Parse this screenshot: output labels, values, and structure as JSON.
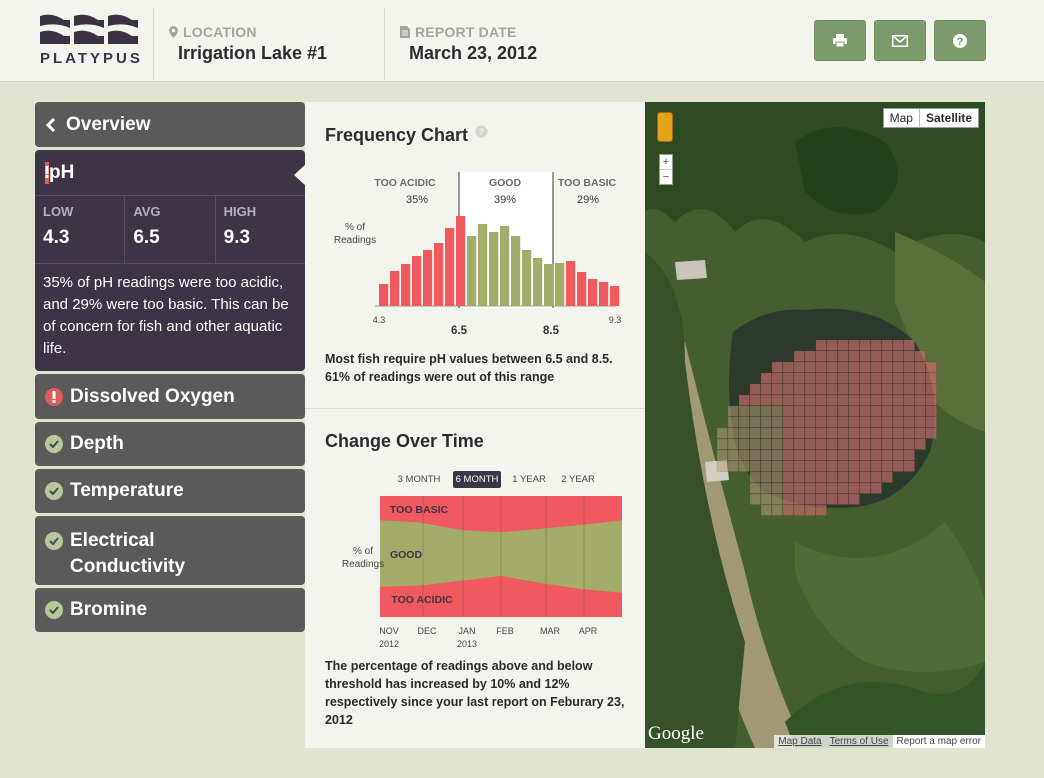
{
  "brand": {
    "name": "PLATYPUS"
  },
  "header": {
    "location_label": "LOCATION",
    "location_value": "Irrigation Lake #1",
    "date_label": "REPORT DATE",
    "date_value": "March 23, 2012",
    "buttons": [
      {
        "name": "print",
        "icon": "printer-icon"
      },
      {
        "name": "email",
        "icon": "envelope-icon"
      },
      {
        "name": "help",
        "icon": "question-icon"
      }
    ]
  },
  "sidebar": {
    "overview": "Overview",
    "active": {
      "title": "pH",
      "stats": [
        {
          "label": "LOW",
          "value": "4.3"
        },
        {
          "label": "AVG",
          "value": "6.5"
        },
        {
          "label": "HIGH",
          "value": "9.3"
        }
      ],
      "description": "35% of pH readings were too acidic, and 29% were too basic. This can be of concern for fish and other aquatic life."
    },
    "items": [
      {
        "label": "Dissolved Oxygen",
        "status": "alert"
      },
      {
        "label": "Depth",
        "status": "ok"
      },
      {
        "label": "Temperature",
        "status": "ok"
      },
      {
        "label": "Electrical Conductivity",
        "status": "ok"
      },
      {
        "label": "Bromine",
        "status": "ok"
      }
    ]
  },
  "frequency": {
    "title": "Frequency Chart",
    "caption": "Most fish require pH values between 6.5 and 8.5. 61% of readings were out of this range",
    "chart_data": {
      "type": "bar",
      "ylabel": "% of Readings",
      "zones": [
        {
          "label": "TOO ACIDIC",
          "pct": "35%"
        },
        {
          "label": "GOOD",
          "pct": "39%"
        },
        {
          "label": "TOO BASIC",
          "pct": "29%"
        }
      ],
      "x_ticks": [
        "4.3",
        "6.5",
        "8.5",
        "9.3"
      ],
      "bins": [
        {
          "v": 0.22,
          "zone": "acid"
        },
        {
          "v": 0.35,
          "zone": "acid"
        },
        {
          "v": 0.42,
          "zone": "acid"
        },
        {
          "v": 0.5,
          "zone": "acid"
        },
        {
          "v": 0.56,
          "zone": "acid"
        },
        {
          "v": 0.63,
          "zone": "acid"
        },
        {
          "v": 0.78,
          "zone": "acid"
        },
        {
          "v": 0.9,
          "zone": "acid"
        },
        {
          "v": 0.7,
          "zone": "good"
        },
        {
          "v": 0.82,
          "zone": "good"
        },
        {
          "v": 0.74,
          "zone": "good"
        },
        {
          "v": 0.8,
          "zone": "good"
        },
        {
          "v": 0.7,
          "zone": "good"
        },
        {
          "v": 0.56,
          "zone": "good"
        },
        {
          "v": 0.48,
          "zone": "good"
        },
        {
          "v": 0.42,
          "zone": "good"
        },
        {
          "v": 0.43,
          "zone": "good"
        },
        {
          "v": 0.45,
          "zone": "basic"
        },
        {
          "v": 0.34,
          "zone": "basic"
        },
        {
          "v": 0.27,
          "zone": "basic"
        },
        {
          "v": 0.24,
          "zone": "basic"
        },
        {
          "v": 0.2,
          "zone": "basic"
        }
      ]
    }
  },
  "change": {
    "title": "Change Over Time",
    "caption": "The percentage of readings above and below threshold has increased by 10% and 12% respectively since your last report on Feburary 23, 2012",
    "tabs": [
      "3 MONTH",
      "6 MONTH",
      "1 YEAR",
      "2 YEAR"
    ],
    "active_tab": "6 MONTH",
    "chart_data": {
      "type": "area",
      "ylabel": "% of Readings",
      "bands": [
        "TOO BASIC",
        "GOOD",
        "TOO ACIDIC"
      ],
      "x_ticks": [
        {
          "m": "NOV",
          "y": "2012"
        },
        {
          "m": "DEC",
          "y": ""
        },
        {
          "m": "JAN",
          "y": "2013"
        },
        {
          "m": "FEB",
          "y": ""
        },
        {
          "m": "MAR",
          "y": ""
        },
        {
          "m": "APR",
          "y": ""
        }
      ],
      "too_basic_pct": [
        20,
        22,
        28,
        30,
        27,
        24,
        20
      ],
      "too_acidic_pct": [
        25,
        26,
        30,
        34,
        28,
        23,
        20
      ]
    }
  },
  "map": {
    "type_options": [
      "Map",
      "Satellite"
    ],
    "active_type": "Satellite",
    "provider": "Google",
    "footer": [
      "Map Data",
      "Terms of Use",
      "Report a map error"
    ]
  },
  "colors": {
    "acid": "#f0595d",
    "good": "#a3ac68",
    "basic": "#f0595d",
    "accent": "#7c9a6c"
  }
}
